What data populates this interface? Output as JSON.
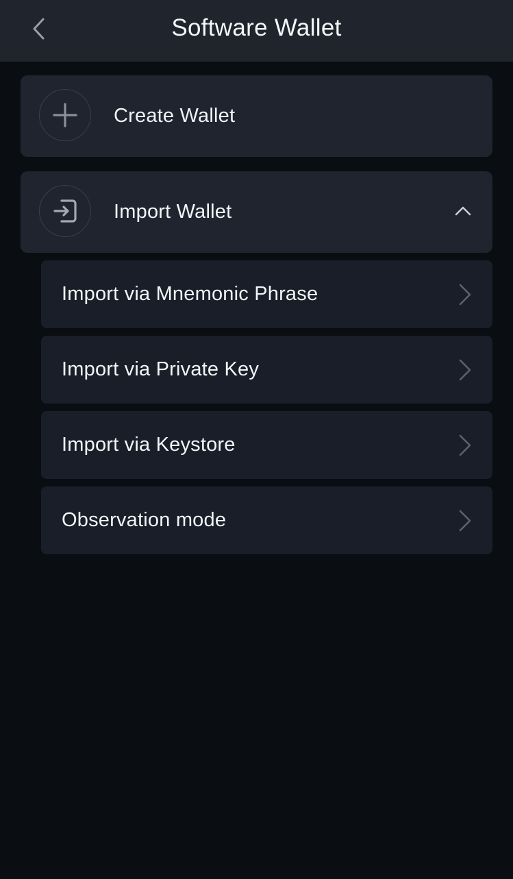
{
  "header": {
    "title": "Software Wallet",
    "back_icon": "chevron-left-icon"
  },
  "create_wallet": {
    "label": "Create Wallet",
    "icon": "plus-icon"
  },
  "import_wallet": {
    "label": "Import Wallet",
    "icon": "import-arrow-icon",
    "expanded": true,
    "caret_icon": "chevron-up-icon",
    "options": [
      {
        "label": "Import via Mnemonic Phrase",
        "icon": "chevron-right-icon"
      },
      {
        "label": "Import via Private Key",
        "icon": "chevron-right-icon"
      },
      {
        "label": "Import via Keystore",
        "icon": "chevron-right-icon"
      },
      {
        "label": "Observation mode",
        "icon": "chevron-right-icon"
      }
    ]
  },
  "colors": {
    "background": "#0a0e12",
    "header": "#1f242d",
    "card": "#1f242e",
    "sub_card": "#1a1e28",
    "text": "#f2f4f7",
    "icon_muted": "#8a909b"
  }
}
